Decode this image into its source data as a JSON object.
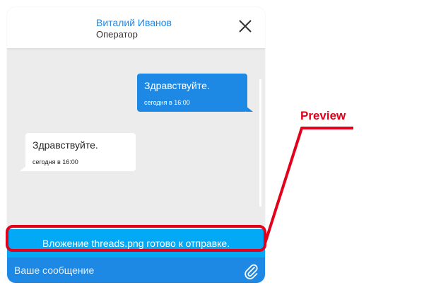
{
  "header": {
    "operator_name": "Виталий Иванов",
    "operator_role": "Оператор"
  },
  "messages": [
    {
      "direction": "outgoing",
      "text": "Здравствуйте.",
      "time": "сегодня в 16:00"
    },
    {
      "direction": "incoming",
      "text": "Здравствуйте.",
      "time": "сегодня в 16:00"
    }
  ],
  "attachment_notice": "Вложение threads.png готово к отправке.",
  "composer": {
    "placeholder": "Ваше сообщение",
    "attach_icon": "paperclip-icon"
  },
  "annotation": {
    "label": "Preview",
    "color": "#e2001a"
  },
  "colors": {
    "accent": "#1e88e5",
    "notice": "#03a9f4",
    "chat_background": "#ececec"
  }
}
